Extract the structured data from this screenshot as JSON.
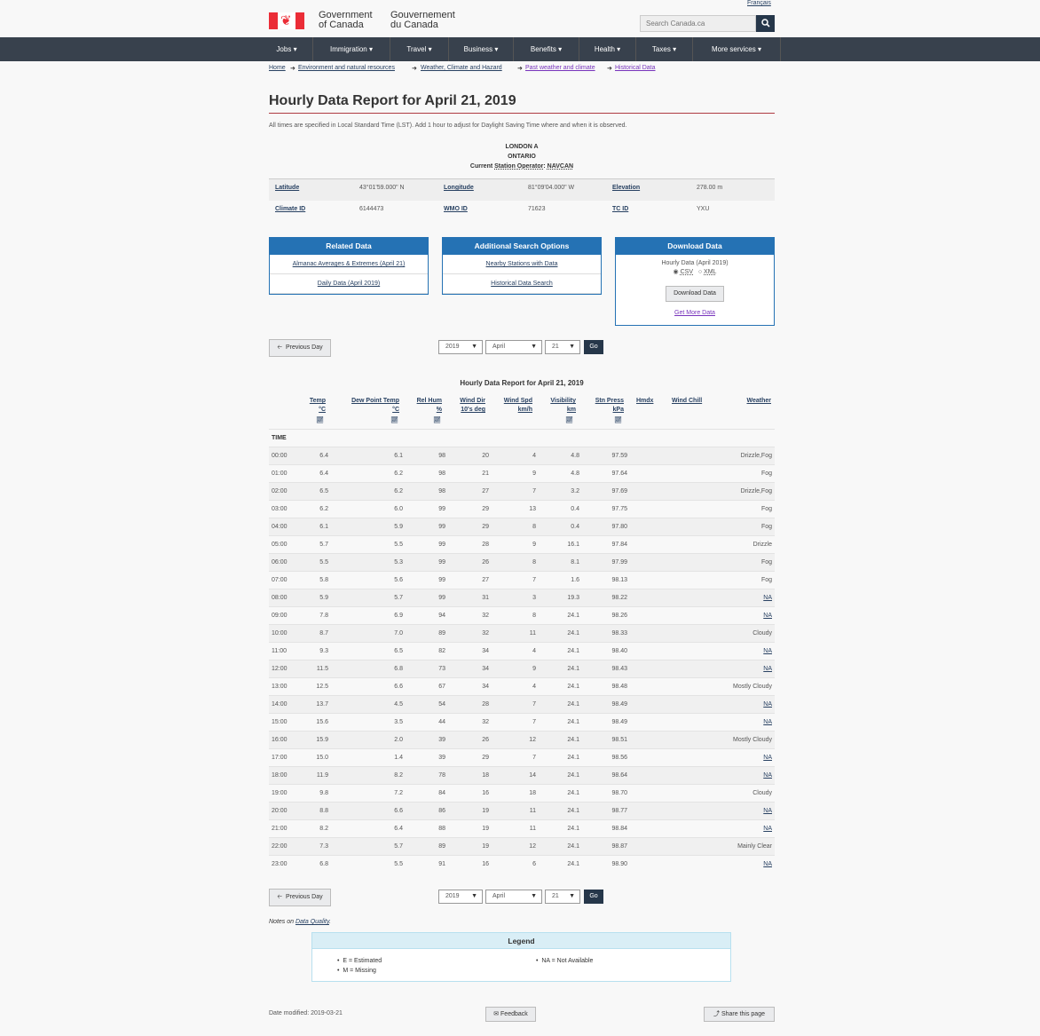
{
  "header": {
    "language_link": "Français",
    "gov_en_line1": "Government",
    "gov_en_line2": "of Canada",
    "gov_fr_line1": "Gouvernement",
    "gov_fr_line2": "du Canada",
    "search_placeholder": "Search Canada.ca",
    "search_icon": "magnifier"
  },
  "menu": [
    "Jobs",
    "Immigration",
    "Travel",
    "Business",
    "Benefits",
    "Health",
    "Taxes",
    "More services"
  ],
  "breadcrumb": [
    "Home",
    "Environment and natural resources",
    "Weather, Climate and Hazard",
    "Past weather and climate",
    "Historical Data"
  ],
  "page": {
    "title": "Hourly Data Report for April 21, 2019",
    "note": "All times are specified in Local Standard Time (LST). Add 1 hour to adjust for Daylight Saving Time where and when it is observed."
  },
  "station": {
    "name": "LONDON A",
    "province": "ONTARIO",
    "operator_prefix": "Current",
    "operator_label": "Station Operator",
    "operator_value": "NAVCAN",
    "latitude_label": "Latitude",
    "latitude": "43°01'59.000\" N",
    "longitude_label": "Longitude",
    "longitude": "81°09'04.000\" W",
    "elevation_label": "Elevation",
    "elevation": "278.00 m",
    "climate_id_label": "Climate ID",
    "climate_id": "6144473",
    "wmo_id_label": "WMO ID",
    "wmo_id": "71623",
    "tc_id_label": "TC ID",
    "tc_id": "YXU"
  },
  "panels": {
    "related": {
      "title": "Related Data",
      "links": [
        "Almanac Averages & Extremes (April 21)",
        "Daily Data (April 2019)"
      ]
    },
    "search": {
      "title": "Additional Search Options",
      "links": [
        "Nearby Stations with Data",
        "Historical Data Search"
      ]
    },
    "download": {
      "title": "Download Data",
      "subtitle": "Hourly Data (April 2019)",
      "opt_csv": "CSV",
      "opt_xml": "XML",
      "button": "Download Data",
      "more_link": "Get More Data"
    }
  },
  "nav": {
    "prev_label": "Previous Day",
    "year": "2019",
    "month": "April",
    "day": "21",
    "go": "Go"
  },
  "table": {
    "title": "Hourly Data Report for April 21, 2019",
    "headers": [
      {
        "l1": "Temp",
        "l2": "°C"
      },
      {
        "l1": "Dew Point Temp",
        "l2": "°C"
      },
      {
        "l1": "Rel Hum",
        "l2": "%"
      },
      {
        "l1": "Wind Dir",
        "l2": "10's deg"
      },
      {
        "l1": "Wind Spd",
        "l2": "km/h"
      },
      {
        "l1": "Visibility",
        "l2": "km"
      },
      {
        "l1": "Stn Press",
        "l2": "kPa"
      },
      {
        "l1": "Hmdx",
        "l2": ""
      },
      {
        "l1": "Wind Chill",
        "l2": ""
      },
      {
        "l1": "Weather",
        "l2": ""
      }
    ],
    "time_label": "TIME",
    "rows": [
      [
        "00:00",
        "6.4",
        "6.1",
        "98",
        "20",
        "4",
        "4.8",
        "97.59",
        "",
        "",
        "Drizzle,Fog"
      ],
      [
        "01:00",
        "6.4",
        "6.2",
        "98",
        "21",
        "9",
        "4.8",
        "97.64",
        "",
        "",
        "Fog"
      ],
      [
        "02:00",
        "6.5",
        "6.2",
        "98",
        "27",
        "7",
        "3.2",
        "97.69",
        "",
        "",
        "Drizzle,Fog"
      ],
      [
        "03:00",
        "6.2",
        "6.0",
        "99",
        "29",
        "13",
        "0.4",
        "97.75",
        "",
        "",
        "Fog"
      ],
      [
        "04:00",
        "6.1",
        "5.9",
        "99",
        "29",
        "8",
        "0.4",
        "97.80",
        "",
        "",
        "Fog"
      ],
      [
        "05:00",
        "5.7",
        "5.5",
        "99",
        "28",
        "9",
        "16.1",
        "97.84",
        "",
        "",
        "Drizzle"
      ],
      [
        "06:00",
        "5.5",
        "5.3",
        "99",
        "26",
        "8",
        "8.1",
        "97.99",
        "",
        "",
        "Fog"
      ],
      [
        "07:00",
        "5.8",
        "5.6",
        "99",
        "27",
        "7",
        "1.6",
        "98.13",
        "",
        "",
        "Fog"
      ],
      [
        "08:00",
        "5.9",
        "5.7",
        "99",
        "31",
        "3",
        "19.3",
        "98.22",
        "",
        "",
        "NA"
      ],
      [
        "09:00",
        "7.8",
        "6.9",
        "94",
        "32",
        "8",
        "24.1",
        "98.26",
        "",
        "",
        "NA"
      ],
      [
        "10:00",
        "8.7",
        "7.0",
        "89",
        "32",
        "11",
        "24.1",
        "98.33",
        "",
        "",
        "Cloudy"
      ],
      [
        "11:00",
        "9.3",
        "6.5",
        "82",
        "34",
        "4",
        "24.1",
        "98.40",
        "",
        "",
        "NA"
      ],
      [
        "12:00",
        "11.5",
        "6.8",
        "73",
        "34",
        "9",
        "24.1",
        "98.43",
        "",
        "",
        "NA"
      ],
      [
        "13:00",
        "12.5",
        "6.6",
        "67",
        "34",
        "4",
        "24.1",
        "98.48",
        "",
        "",
        "Mostly Cloudy"
      ],
      [
        "14:00",
        "13.7",
        "4.5",
        "54",
        "28",
        "7",
        "24.1",
        "98.49",
        "",
        "",
        "NA"
      ],
      [
        "15:00",
        "15.6",
        "3.5",
        "44",
        "32",
        "7",
        "24.1",
        "98.49",
        "",
        "",
        "NA"
      ],
      [
        "16:00",
        "15.9",
        "2.0",
        "39",
        "26",
        "12",
        "24.1",
        "98.51",
        "",
        "",
        "Mostly Cloudy"
      ],
      [
        "17:00",
        "15.0",
        "1.4",
        "39",
        "29",
        "7",
        "24.1",
        "98.56",
        "",
        "",
        "NA"
      ],
      [
        "18:00",
        "11.9",
        "8.2",
        "78",
        "18",
        "14",
        "24.1",
        "98.64",
        "",
        "",
        "NA"
      ],
      [
        "19:00",
        "9.8",
        "7.2",
        "84",
        "16",
        "18",
        "24.1",
        "98.70",
        "",
        "",
        "Cloudy"
      ],
      [
        "20:00",
        "8.8",
        "6.6",
        "86",
        "19",
        "11",
        "24.1",
        "98.77",
        "",
        "",
        "NA"
      ],
      [
        "21:00",
        "8.2",
        "6.4",
        "88",
        "19",
        "11",
        "24.1",
        "98.84",
        "",
        "",
        "NA"
      ],
      [
        "22:00",
        "7.3",
        "5.7",
        "89",
        "19",
        "12",
        "24.1",
        "98.87",
        "",
        "",
        "Mainly Clear"
      ],
      [
        "23:00",
        "6.8",
        "5.5",
        "91",
        "16",
        "6",
        "24.1",
        "98.90",
        "",
        "",
        "NA"
      ]
    ]
  },
  "footer": {
    "notes_prefix": "Notes on",
    "notes_link": "Data Quality",
    "legend_title": "Legend",
    "legend_e": "E = Estimated",
    "legend_m": "M = Missing",
    "legend_na": "NA = Not Available",
    "date_modified": "Date modified: 2019-03-21",
    "feedback": "Feedback",
    "share": "Share this page"
  }
}
